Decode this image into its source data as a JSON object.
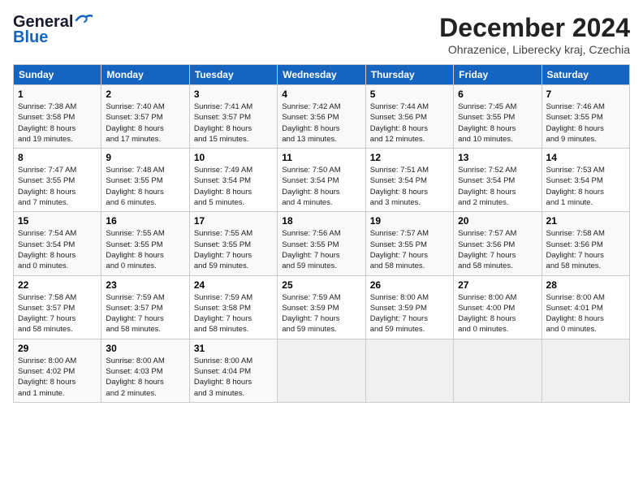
{
  "header": {
    "logo_line1": "General",
    "logo_line2": "Blue",
    "month_year": "December 2024",
    "location": "Ohrazenice, Liberecky kraj, Czechia"
  },
  "weekdays": [
    "Sunday",
    "Monday",
    "Tuesday",
    "Wednesday",
    "Thursday",
    "Friday",
    "Saturday"
  ],
  "weeks": [
    [
      {
        "day": "1",
        "sunrise": "7:38 AM",
        "sunset": "3:58 PM",
        "daylight": "8 hours and 19 minutes."
      },
      {
        "day": "2",
        "sunrise": "7:40 AM",
        "sunset": "3:57 PM",
        "daylight": "8 hours and 17 minutes."
      },
      {
        "day": "3",
        "sunrise": "7:41 AM",
        "sunset": "3:57 PM",
        "daylight": "8 hours and 15 minutes."
      },
      {
        "day": "4",
        "sunrise": "7:42 AM",
        "sunset": "3:56 PM",
        "daylight": "8 hours and 13 minutes."
      },
      {
        "day": "5",
        "sunrise": "7:44 AM",
        "sunset": "3:56 PM",
        "daylight": "8 hours and 12 minutes."
      },
      {
        "day": "6",
        "sunrise": "7:45 AM",
        "sunset": "3:55 PM",
        "daylight": "8 hours and 10 minutes."
      },
      {
        "day": "7",
        "sunrise": "7:46 AM",
        "sunset": "3:55 PM",
        "daylight": "8 hours and 9 minutes."
      }
    ],
    [
      {
        "day": "8",
        "sunrise": "7:47 AM",
        "sunset": "3:55 PM",
        "daylight": "8 hours and 7 minutes."
      },
      {
        "day": "9",
        "sunrise": "7:48 AM",
        "sunset": "3:55 PM",
        "daylight": "8 hours and 6 minutes."
      },
      {
        "day": "10",
        "sunrise": "7:49 AM",
        "sunset": "3:54 PM",
        "daylight": "8 hours and 5 minutes."
      },
      {
        "day": "11",
        "sunrise": "7:50 AM",
        "sunset": "3:54 PM",
        "daylight": "8 hours and 4 minutes."
      },
      {
        "day": "12",
        "sunrise": "7:51 AM",
        "sunset": "3:54 PM",
        "daylight": "8 hours and 3 minutes."
      },
      {
        "day": "13",
        "sunrise": "7:52 AM",
        "sunset": "3:54 PM",
        "daylight": "8 hours and 2 minutes."
      },
      {
        "day": "14",
        "sunrise": "7:53 AM",
        "sunset": "3:54 PM",
        "daylight": "8 hours and 1 minute."
      }
    ],
    [
      {
        "day": "15",
        "sunrise": "7:54 AM",
        "sunset": "3:54 PM",
        "daylight": "8 hours and 0 minutes."
      },
      {
        "day": "16",
        "sunrise": "7:55 AM",
        "sunset": "3:55 PM",
        "daylight": "8 hours and 0 minutes."
      },
      {
        "day": "17",
        "sunrise": "7:55 AM",
        "sunset": "3:55 PM",
        "daylight": "7 hours and 59 minutes."
      },
      {
        "day": "18",
        "sunrise": "7:56 AM",
        "sunset": "3:55 PM",
        "daylight": "7 hours and 59 minutes."
      },
      {
        "day": "19",
        "sunrise": "7:57 AM",
        "sunset": "3:55 PM",
        "daylight": "7 hours and 58 minutes."
      },
      {
        "day": "20",
        "sunrise": "7:57 AM",
        "sunset": "3:56 PM",
        "daylight": "7 hours and 58 minutes."
      },
      {
        "day": "21",
        "sunrise": "7:58 AM",
        "sunset": "3:56 PM",
        "daylight": "7 hours and 58 minutes."
      }
    ],
    [
      {
        "day": "22",
        "sunrise": "7:58 AM",
        "sunset": "3:57 PM",
        "daylight": "7 hours and 58 minutes."
      },
      {
        "day": "23",
        "sunrise": "7:59 AM",
        "sunset": "3:57 PM",
        "daylight": "7 hours and 58 minutes."
      },
      {
        "day": "24",
        "sunrise": "7:59 AM",
        "sunset": "3:58 PM",
        "daylight": "7 hours and 58 minutes."
      },
      {
        "day": "25",
        "sunrise": "7:59 AM",
        "sunset": "3:59 PM",
        "daylight": "7 hours and 59 minutes."
      },
      {
        "day": "26",
        "sunrise": "8:00 AM",
        "sunset": "3:59 PM",
        "daylight": "7 hours and 59 minutes."
      },
      {
        "day": "27",
        "sunrise": "8:00 AM",
        "sunset": "4:00 PM",
        "daylight": "8 hours and 0 minutes."
      },
      {
        "day": "28",
        "sunrise": "8:00 AM",
        "sunset": "4:01 PM",
        "daylight": "8 hours and 0 minutes."
      }
    ],
    [
      {
        "day": "29",
        "sunrise": "8:00 AM",
        "sunset": "4:02 PM",
        "daylight": "8 hours and 1 minute."
      },
      {
        "day": "30",
        "sunrise": "8:00 AM",
        "sunset": "4:03 PM",
        "daylight": "8 hours and 2 minutes."
      },
      {
        "day": "31",
        "sunrise": "8:00 AM",
        "sunset": "4:04 PM",
        "daylight": "8 hours and 3 minutes."
      },
      null,
      null,
      null,
      null
    ]
  ]
}
